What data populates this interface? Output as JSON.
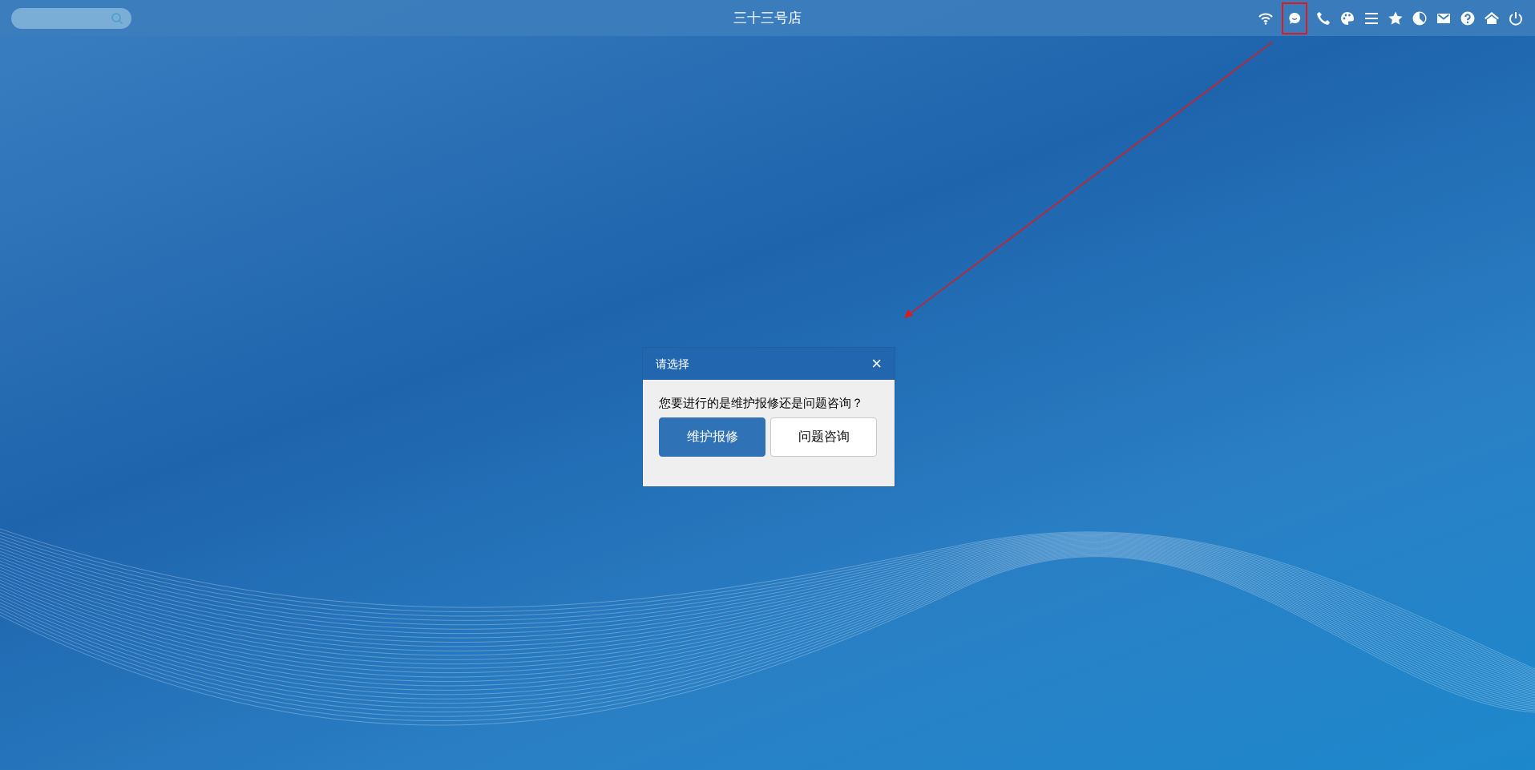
{
  "top_bar": {
    "title": "三十三号店"
  },
  "dialog": {
    "title": "请选择",
    "close": "×",
    "message": "您要进行的是维护报修还是问题咨询？",
    "buttons": [
      {
        "label": "维护报修",
        "kind": "primary"
      },
      {
        "label": "问题咨询",
        "kind": "default"
      }
    ]
  }
}
